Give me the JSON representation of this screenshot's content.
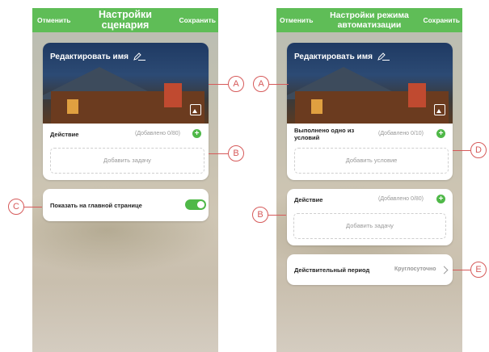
{
  "left_screen": {
    "cancel": "Отменить",
    "title_line1": "Настройки",
    "title_line2": "сценария",
    "save": "Сохранить",
    "edit_name": "Редактировать имя",
    "action_label": "Действие",
    "action_count": "(Добавлено 0/80)",
    "add_task": "Добавить задачу",
    "show_on_home": "Показать на главной странице",
    "show_on_home_enabled": true
  },
  "right_screen": {
    "cancel": "Отменить",
    "title_line1": "Настройки режима",
    "title_line2": "автоматизации",
    "save": "Сохранить",
    "edit_name": "Редактировать имя",
    "condition_label": "Выполнено одно из условий",
    "condition_count": "(Добавлено 0/10)",
    "add_condition": "Добавить условие",
    "action_label": "Действие",
    "action_count": "(Добавлено 0/80)",
    "add_task": "Добавить задачу",
    "valid_period_label": "Действительный период",
    "valid_period_value": "Круглосуточно"
  },
  "callouts": {
    "a1": "A",
    "a2": "A",
    "b1": "B",
    "b2": "B",
    "c": "C",
    "d": "D",
    "e": "E"
  },
  "colors": {
    "header_green": "#5fbd57",
    "accent_green": "#4fb848",
    "callout_red": "#d65a5a"
  },
  "icons": [
    "pencil-icon",
    "image-icon",
    "plus-icon",
    "chevron-right-icon",
    "toggle-switch"
  ]
}
